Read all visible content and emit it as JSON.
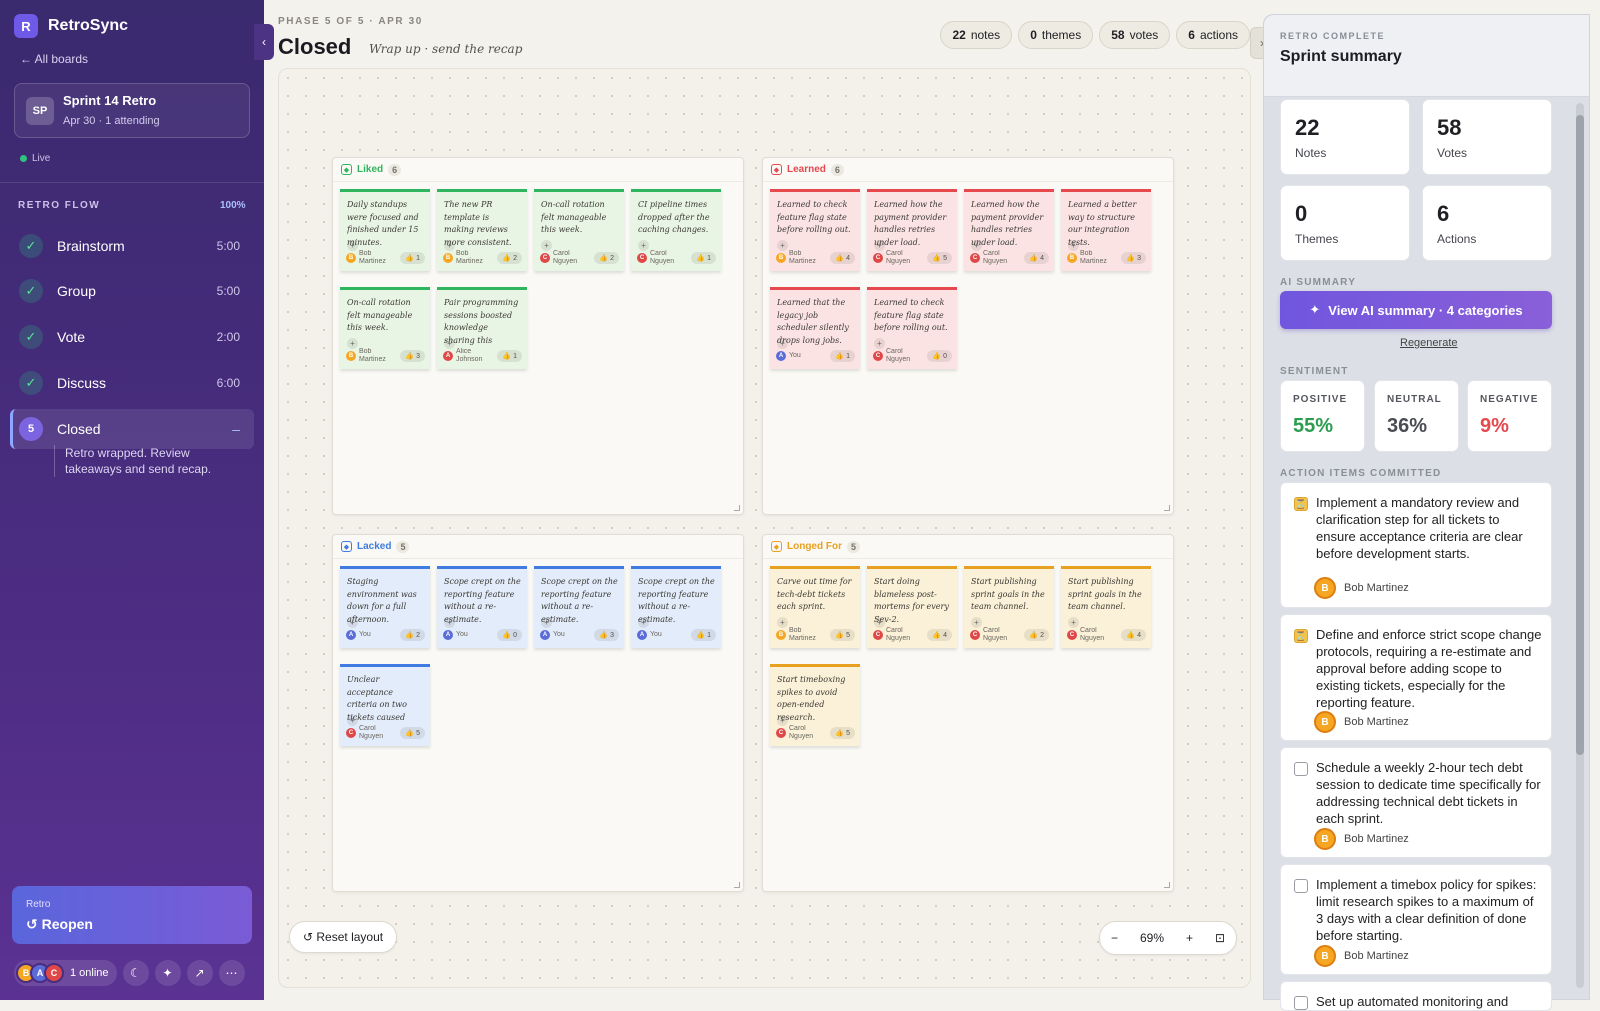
{
  "app": {
    "brand_mark": "R",
    "brand_name": "RetroSync",
    "back_link": "← All boards"
  },
  "board": {
    "avatar": "SP",
    "title": "Sprint 14 Retro",
    "subtitle": "Apr 30 · 1 attending",
    "status": "Live"
  },
  "flow": {
    "heading": "RETRO FLOW",
    "progress": "100%",
    "steps": [
      {
        "label": "Brainstorm",
        "time": "5:00",
        "done": true
      },
      {
        "label": "Group",
        "time": "5:00",
        "done": true
      },
      {
        "label": "Vote",
        "time": "2:00",
        "done": true
      },
      {
        "label": "Discuss",
        "time": "6:00",
        "done": true
      },
      {
        "label": "Closed",
        "number": "5",
        "time": "–",
        "active": true
      }
    ],
    "active_note": "Retro wrapped. Review takeaways and send recap."
  },
  "reopen": {
    "small": "Retro",
    "label": "↺ Reopen"
  },
  "footer": {
    "avatars": [
      "B",
      "A",
      "C"
    ],
    "online": "1 online"
  },
  "header": {
    "phase": "PHASE 5 OF 5 · APR 30",
    "title": "Closed",
    "subtitle": "Wrap up · send the recap",
    "stats": [
      {
        "value": "22",
        "label": "notes"
      },
      {
        "value": "0",
        "label": "themes"
      },
      {
        "value": "58",
        "label": "votes"
      },
      {
        "value": "6",
        "label": "actions"
      }
    ]
  },
  "columns": [
    {
      "name": "Liked",
      "count": "6",
      "color": "#2fb55d",
      "bg": "#e9f5e4",
      "notes": [
        {
          "text": "Daily standups were focused and finished under 15 minutes.",
          "author": "Bob Martinez",
          "initial": "B",
          "av": "#f5a623",
          "votes": "1"
        },
        {
          "text": "The new PR template is making reviews more consistent.",
          "author": "Bob Martinez",
          "initial": "B",
          "av": "#f5a623",
          "votes": "2"
        },
        {
          "text": "On-call rotation felt manageable this week.",
          "author": "Carol Nguyen",
          "initial": "C",
          "av": "#e04848",
          "votes": "2"
        },
        {
          "text": "CI pipeline times dropped after the caching changes.",
          "author": "Carol Nguyen",
          "initial": "C",
          "av": "#e04848",
          "votes": "1"
        },
        {
          "text": "On-call rotation felt manageable this week.",
          "author": "Bob Martinez",
          "initial": "B",
          "av": "#f5a623",
          "votes": "3"
        },
        {
          "text": "Pair programming sessions boosted knowledge sharing this sprint.",
          "author": "Alice Johnson",
          "initial": "A",
          "av": "#e04848",
          "votes": "1"
        }
      ]
    },
    {
      "name": "Learned",
      "count": "6",
      "color": "#e5484d",
      "bg": "#fbe3e3",
      "notes": [
        {
          "text": "Learned to check feature flag state before rolling out.",
          "author": "Bob Martinez",
          "initial": "B",
          "av": "#f5a623",
          "votes": "4"
        },
        {
          "text": "Learned how the payment provider handles retries under load.",
          "author": "Carol Nguyen",
          "initial": "C",
          "av": "#e04848",
          "votes": "5"
        },
        {
          "text": "Learned how the payment provider handles retries under load.",
          "author": "Carol Nguyen",
          "initial": "C",
          "av": "#e04848",
          "votes": "4"
        },
        {
          "text": "Learned a better way to structure our integration tests.",
          "author": "Bob Martinez",
          "initial": "B",
          "av": "#f5a623",
          "votes": "3"
        },
        {
          "text": "Learned that the legacy job scheduler silently drops long jobs.",
          "author": "You",
          "initial": "A",
          "av": "#5b6bd8",
          "votes": "1"
        },
        {
          "text": "Learned to check feature flag state before rolling out.",
          "author": "Carol Nguyen",
          "initial": "C",
          "av": "#e04848",
          "votes": "0"
        }
      ]
    },
    {
      "name": "Lacked",
      "count": "5",
      "color": "#3f7be0",
      "bg": "#e3ecfa",
      "notes": [
        {
          "text": "Staging environment was down for a full afternoon.",
          "author": "You",
          "initial": "A",
          "av": "#5b6bd8",
          "votes": "2"
        },
        {
          "text": "Scope crept on the reporting feature without a re-estimate.",
          "author": "You",
          "initial": "A",
          "av": "#5b6bd8",
          "votes": "0"
        },
        {
          "text": "Scope crept on the reporting feature without a re-estimate.",
          "author": "You",
          "initial": "A",
          "av": "#5b6bd8",
          "votes": "3"
        },
        {
          "text": "Scope crept on the reporting feature without a re-estimate.",
          "author": "You",
          "initial": "A",
          "av": "#5b6bd8",
          "votes": "1"
        },
        {
          "text": "Unclear acceptance criteria on two tickets caused rework.",
          "author": "Carol Nguyen",
          "initial": "C",
          "av": "#e04848",
          "votes": "5"
        }
      ]
    },
    {
      "name": "Longed For",
      "count": "5",
      "color": "#e8a020",
      "bg": "#fbf1d8",
      "notes": [
        {
          "text": "Carve out time for tech-debt tickets each sprint.",
          "author": "Bob Martinez",
          "initial": "B",
          "av": "#f5a623",
          "votes": "5"
        },
        {
          "text": "Start doing blameless post-mortems for every Sev-2.",
          "author": "Carol Nguyen",
          "initial": "C",
          "av": "#e04848",
          "votes": "4"
        },
        {
          "text": "Start publishing sprint goals in the team channel.",
          "author": "Carol Nguyen",
          "initial": "C",
          "av": "#e04848",
          "votes": "2"
        },
        {
          "text": "Start publishing sprint goals in the team channel.",
          "author": "Carol Nguyen",
          "initial": "C",
          "av": "#e04848",
          "votes": "4"
        },
        {
          "text": "Start timeboxing spikes to avoid open-ended research.",
          "author": "Carol Nguyen",
          "initial": "C",
          "av": "#e04848",
          "votes": "5"
        }
      ]
    }
  ],
  "canvas": {
    "reset": "↺ Reset layout",
    "zoom": "69%",
    "zoom_out": "−",
    "zoom_in": "+"
  },
  "summary": {
    "eyebrow": "RETRO COMPLETE",
    "title": "Sprint summary",
    "stats": [
      {
        "value": "22",
        "label": "Notes"
      },
      {
        "value": "58",
        "label": "Votes"
      },
      {
        "value": "0",
        "label": "Themes"
      },
      {
        "value": "6",
        "label": "Actions"
      }
    ],
    "ai_heading": "AI SUMMARY",
    "ai_button": "View AI summary · 4 categories",
    "regenerate": "Regenerate",
    "sentiment_heading": "SENTIMENT",
    "sentiment": [
      {
        "label": "POSITIVE",
        "value": "55%",
        "color": "#2a9d4f"
      },
      {
        "label": "NEUTRAL",
        "value": "36%",
        "color": "#4a4c53"
      },
      {
        "label": "NEGATIVE",
        "value": "9%",
        "color": "#e5484d"
      }
    ],
    "actions_heading": "ACTION ITEMS COMMITTED",
    "actions": [
      {
        "text": "Implement a mandatory review and clarification step for all tickets to ensure acceptance criteria are clear before development starts.",
        "owner": "Bob Martinez",
        "checked": true
      },
      {
        "text": "Define and enforce strict scope change protocols, requiring a re-estimate and approval before adding scope to existing tickets, especially for the reporting feature.",
        "owner": "Bob Martinez",
        "checked": true
      },
      {
        "text": "Schedule a weekly 2-hour tech debt session to dedicate time specifically for addressing technical debt tickets in each sprint.",
        "owner": "Bob Martinez",
        "checked": false
      },
      {
        "text": "Implement a timebox policy for spikes: limit research spikes to a maximum of 3 days with a clear definition of done before starting.",
        "owner": "Bob Martinez",
        "checked": false
      },
      {
        "text": "Set up automated monitoring and",
        "owner": "",
        "checked": false
      }
    ]
  }
}
